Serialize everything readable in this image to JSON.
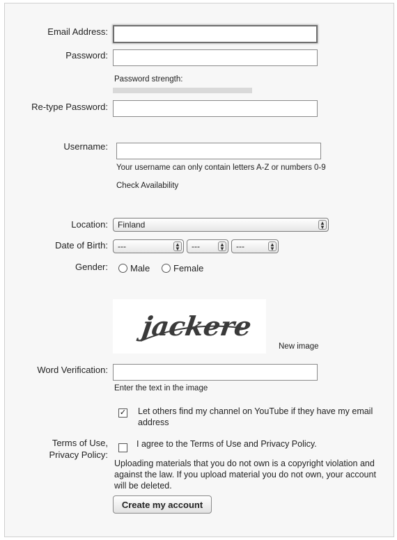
{
  "form": {
    "email": {
      "label": "Email Address:",
      "value": ""
    },
    "password": {
      "label": "Password:",
      "value": "",
      "strength_label": "Password strength:"
    },
    "retype": {
      "label": "Re-type Password:",
      "value": ""
    },
    "username": {
      "label": "Username:",
      "value": "",
      "hint": "Your username can only contain letters A-Z or numbers 0-9",
      "check_link": "Check Availability"
    },
    "location": {
      "label": "Location:",
      "selected": "Finland"
    },
    "dob": {
      "label": "Date of Birth:",
      "month": "---",
      "day": "---",
      "year": "---"
    },
    "gender": {
      "label": "Gender:",
      "male": "Male",
      "female": "Female"
    },
    "captcha": {
      "text": "jackere",
      "new_image": "New image"
    },
    "word_verification": {
      "label": "Word Verification:",
      "value": "",
      "hint": "Enter the text in the image"
    },
    "find_channel": {
      "checked": true,
      "text": "Let others find my channel on YouTube if they have my email address"
    },
    "terms": {
      "label_line1": "Terms of Use,",
      "label_line2": "Privacy Policy:",
      "checked": false,
      "agree_text": "I agree to the Terms of Use and Privacy Policy.",
      "notice": "Uploading materials that you do not own is a copyright violation and against the law. If you upload material you do not own, your account will be deleted."
    },
    "submit_label": "Create my account"
  }
}
